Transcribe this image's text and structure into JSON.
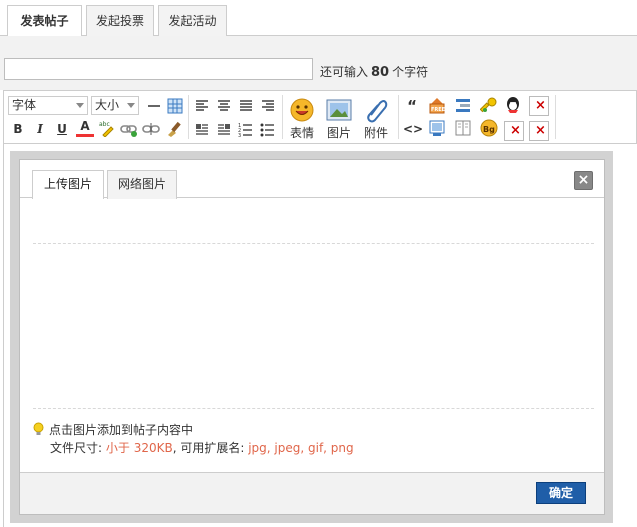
{
  "top_tabs": [
    {
      "label": "发表帖子",
      "active": true
    },
    {
      "label": "发起投票",
      "active": false
    },
    {
      "label": "发起活动",
      "active": false
    }
  ],
  "subject": {
    "value": "",
    "placeholder": "",
    "counter_prefix": "还可输入",
    "counter_value": "80",
    "counter_suffix": "个字符"
  },
  "toolbar": {
    "font_select": "字体",
    "size_select": "大小",
    "bold": "B",
    "italic": "I",
    "underline": "U",
    "font_color": "A",
    "smiley_label": "表情",
    "image_label": "图片",
    "attach_label": "附件",
    "quote": "“",
    "code": "<>"
  },
  "dialog": {
    "tabs": [
      {
        "label": "上传图片",
        "active": true
      },
      {
        "label": "网络图片",
        "active": false
      }
    ],
    "close": "×",
    "hint_title": "点击图片添加到帖子内容中",
    "size_prefix": "文件尺寸:",
    "size_value": "小于 320KB",
    "ext_prefix": ", 可用扩展名:",
    "ext_value": "jpg, jpeg, gif, png",
    "ok_label": "确定"
  },
  "colors": {
    "accent_button": "#1f5ea8",
    "hint_red": "#e0664a"
  }
}
